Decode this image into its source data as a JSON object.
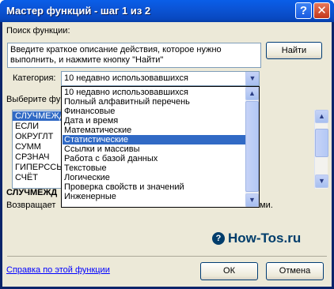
{
  "window": {
    "title": "Мастер функций - шаг 1 из 2",
    "help_label": "?",
    "close_label": "✕"
  },
  "search": {
    "label": "Поиск функции:",
    "text_line1": "Введите краткое описание действия, которое нужно",
    "text_line2": "выполнить, и нажмите кнопку \"Найти\"",
    "find_button": "Найти"
  },
  "category": {
    "label": "Категория:",
    "selected": "10 недавно использовавшихся",
    "options": [
      "10 недавно использовавшихся",
      "Полный алфавитный перечень",
      "Финансовые",
      "Дата и время",
      "Математические",
      "Статистические",
      "Ссылки и массивы",
      "Работа с базой данных",
      "Текстовые",
      "Логические",
      "Проверка свойств и значений",
      "Инженерные"
    ],
    "highlighted_index": 5
  },
  "functions": {
    "label": "Выберите фун",
    "items": [
      "СЛУЧМЕЖДУ",
      "ЕСЛИ",
      "ОКРУГЛТ",
      "СУММ",
      "СРЗНАЧ",
      "ГИПЕРССЫЛ",
      "СЧЁТ"
    ],
    "selected_index": 0
  },
  "description": {
    "function_name": "СЛУЧМЕЖД",
    "text": "Возвращает",
    "text_tail": "ми."
  },
  "footer": {
    "help_link": "Справка по этой функции",
    "ok_button": "ОК",
    "cancel_button": "Отмена"
  },
  "watermark": {
    "text": "How-Tos.ru",
    "icon": "?"
  },
  "icons": {
    "dropdown_arrow": "chevron-down-icon",
    "scroll_up": "chevron-up-icon",
    "scroll_down": "chevron-down-icon"
  },
  "colors": {
    "titlebar": "#0b54d6",
    "selection": "#316ac5",
    "dialog_bg": "#ece9d8",
    "link": "#0000ff",
    "close_button": "#c4371b"
  }
}
